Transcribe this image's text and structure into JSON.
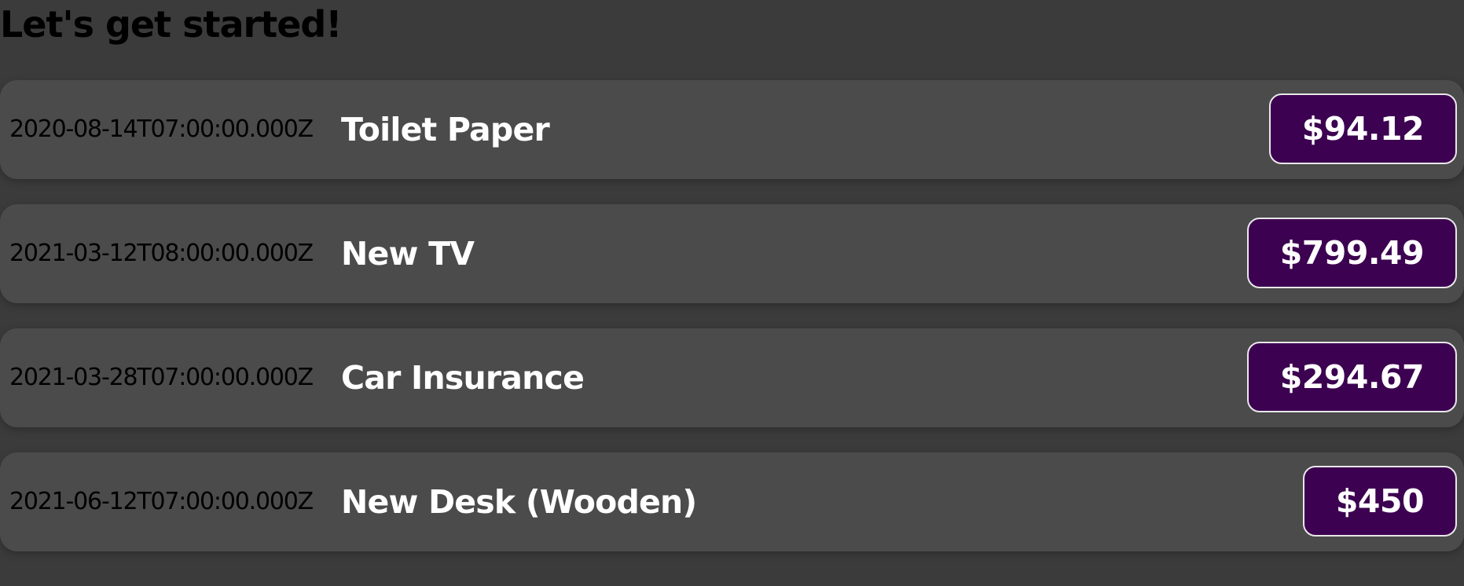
{
  "header": {
    "title": "Let's get started!"
  },
  "colors": {
    "background": "#3b3b3b",
    "card": "#4b4b4b",
    "price_badge": "#3c0150",
    "price_badge_border": "#e8e8e8"
  },
  "expenses": [
    {
      "date": "2020-08-14T07:00:00.000Z",
      "title": "Toilet Paper",
      "amount": "$94.12"
    },
    {
      "date": "2021-03-12T08:00:00.000Z",
      "title": "New TV",
      "amount": "$799.49"
    },
    {
      "date": "2021-03-28T07:00:00.000Z",
      "title": "Car Insurance",
      "amount": "$294.67"
    },
    {
      "date": "2021-06-12T07:00:00.000Z",
      "title": "New Desk (Wooden)",
      "amount": "$450"
    }
  ]
}
